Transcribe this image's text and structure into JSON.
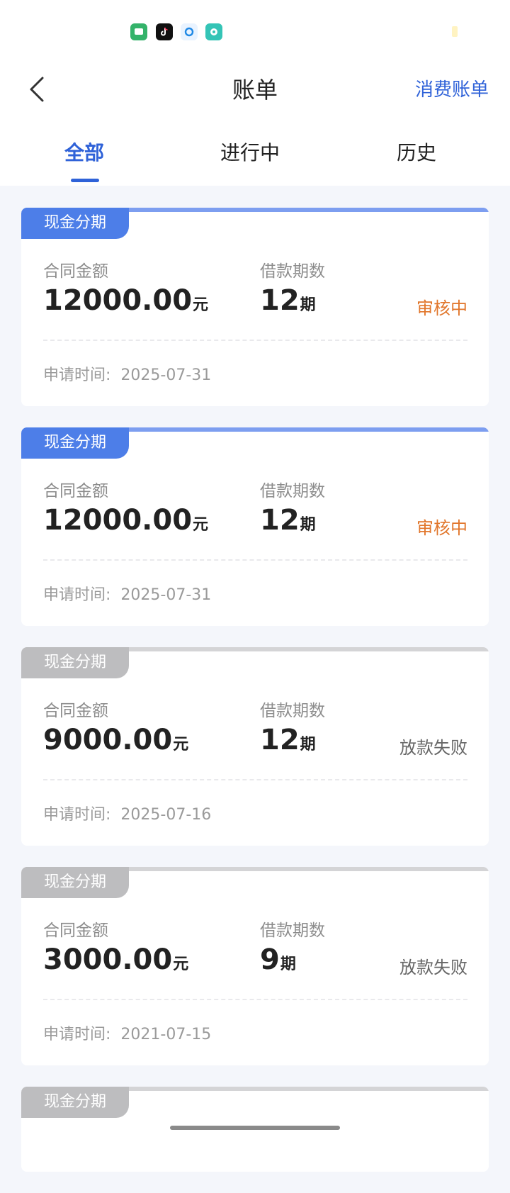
{
  "nav": {
    "title": "账单",
    "right_link": "消费账单"
  },
  "tabs": [
    {
      "label": "全部",
      "active": true
    },
    {
      "label": "进行中",
      "active": false
    },
    {
      "label": "历史",
      "active": false
    }
  ],
  "cards": [
    {
      "badge": "现金分期",
      "badge_color": "#4d7ee8",
      "amount_label": "合同金额",
      "amount": "12000.00",
      "amount_unit": "元",
      "periods_label": "借款期数",
      "periods": "12",
      "periods_unit": "期",
      "status": "审核中",
      "apply_label": "申请时间:",
      "apply_date": "2025-07-31"
    },
    {
      "badge": "现金分期",
      "badge_color": "#4d7ee8",
      "amount_label": "合同金额",
      "amount": "12000.00",
      "amount_unit": "元",
      "periods_label": "借款期数",
      "periods": "12",
      "periods_unit": "期",
      "status": "审核中",
      "apply_label": "申请时间:",
      "apply_date": "2025-07-31"
    },
    {
      "badge": "现金分期",
      "badge_color": "#bdbdbf",
      "amount_label": "合同金额",
      "amount": "9000.00",
      "amount_unit": "元",
      "periods_label": "借款期数",
      "periods": "12",
      "periods_unit": "期",
      "status": "放款失败",
      "apply_label": "申请时间:",
      "apply_date": "2025-07-16"
    },
    {
      "badge": "现金分期",
      "badge_color": "#bdbdbf",
      "amount_label": "合同金额",
      "amount": "3000.00",
      "amount_unit": "元",
      "periods_label": "借款期数",
      "periods": "9",
      "periods_unit": "期",
      "status": "放款失败",
      "apply_label": "申请时间:",
      "apply_date": "2021-07-15"
    },
    {
      "badge": "现金分期",
      "badge_color": "#bdbdbf"
    }
  ],
  "colors": {
    "accent": "#2f62d8",
    "pending": "#e1762b",
    "failed": "#666666"
  }
}
